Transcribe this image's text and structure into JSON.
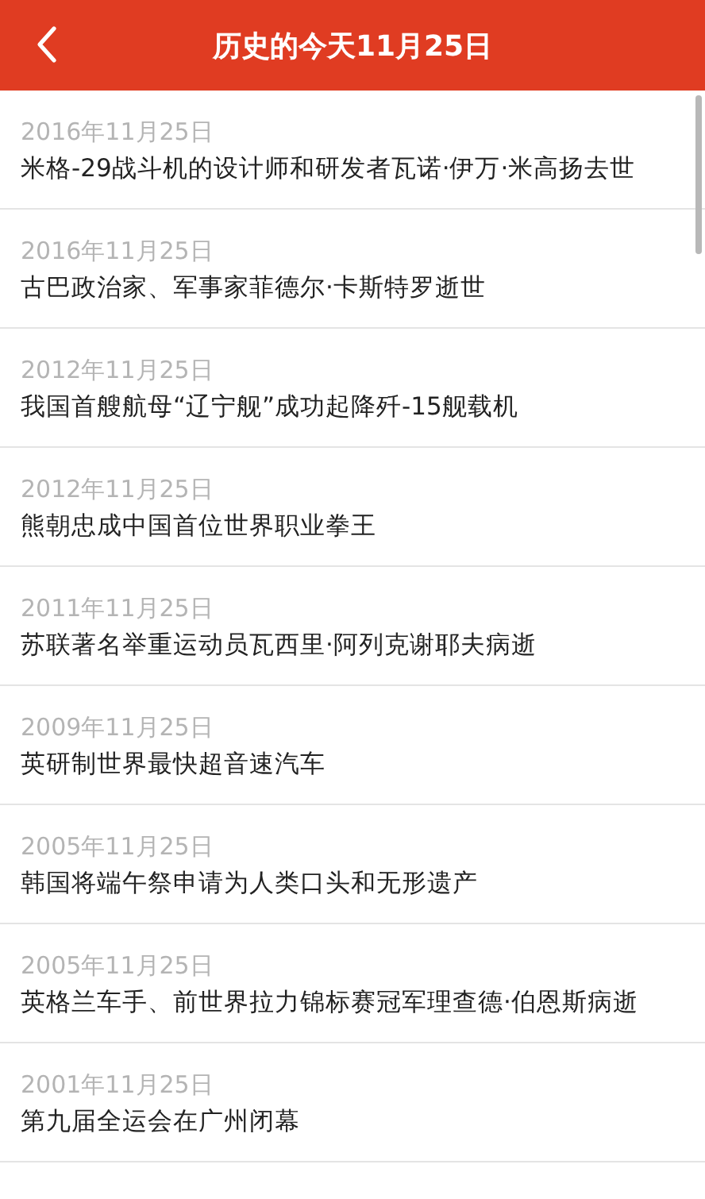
{
  "header": {
    "title": "历史的今天11月25日"
  },
  "events": [
    {
      "date": "2016年11月25日",
      "title": "米格-29战斗机的设计师和研发者瓦诺·伊万·米高扬去世"
    },
    {
      "date": "2016年11月25日",
      "title": "古巴政治家、军事家菲德尔·卡斯特罗逝世"
    },
    {
      "date": "2012年11月25日",
      "title": "我国首艘航母“辽宁舰”成功起降歼-15舰载机"
    },
    {
      "date": "2012年11月25日",
      "title": "熊朝忠成中国首位世界职业拳王"
    },
    {
      "date": "2011年11月25日",
      "title": "苏联著名举重运动员瓦西里·阿列克谢耶夫病逝"
    },
    {
      "date": "2009年11月25日",
      "title": "英研制世界最快超音速汽车"
    },
    {
      "date": "2005年11月25日",
      "title": "韩国将端午祭申请为人类口头和无形遗产"
    },
    {
      "date": "2005年11月25日",
      "title": "英格兰车手、前世界拉力锦标赛冠军理查德·伯恩斯病逝"
    },
    {
      "date": "2001年11月25日",
      "title": "第九届全运会在广州闭幕"
    }
  ]
}
